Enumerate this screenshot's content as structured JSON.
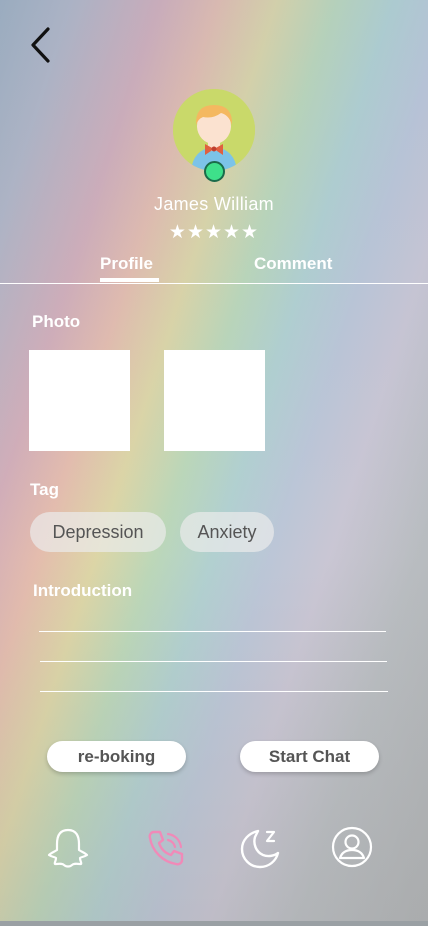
{
  "profile": {
    "name": "James William",
    "rating_text": "★★★★★",
    "rating": 5,
    "online_color": "#3ee08a"
  },
  "tabs": [
    {
      "label": "Profile",
      "active": true
    },
    {
      "label": "Comment",
      "active": false
    }
  ],
  "sections": {
    "photo_title": "Photo",
    "tag_title": "Tag",
    "intro_title": "Introduction"
  },
  "tags": [
    "Depression",
    "Anxiety"
  ],
  "actions": {
    "rebook_label": "re-boking",
    "chat_label": "Start Chat"
  },
  "bottom_nav": [
    {
      "icon": "ghost-icon",
      "active": false
    },
    {
      "icon": "phone-icon",
      "active": true,
      "color": "#f08ab8"
    },
    {
      "icon": "sleep-moon-icon",
      "active": false
    },
    {
      "icon": "user-icon",
      "active": false
    }
  ]
}
